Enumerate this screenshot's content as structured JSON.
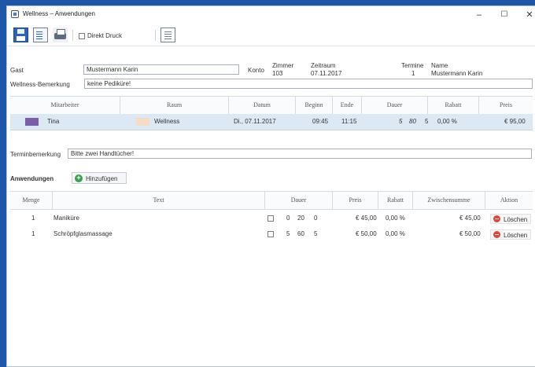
{
  "window": {
    "title": "Wellness – Anwendungen",
    "controls": {
      "minimize": "–",
      "maximize": "☐",
      "close": "✕"
    }
  },
  "toolbar": {
    "icons": [
      "save-icon",
      "preview-icon",
      "printer-icon",
      "list-icon"
    ],
    "direkt_druck_label": "Direkt Druck"
  },
  "guest": {
    "label": "Gast",
    "value": "Mustermann Karin",
    "konto_label": "Konto",
    "zimmer_label": "Zimmer",
    "zimmer_value": "103",
    "zeitraum_label": "Zeitraum",
    "zeitraum_value": "07.11.2017",
    "termine_label": "Termine",
    "termine_value": "1",
    "name_label": "Name",
    "name_value": "Mustermann Karin"
  },
  "wellness_bemerkung": {
    "label": "Wellness-Bemerkung",
    "value": "keine Pediküre!"
  },
  "appointments": {
    "columns": [
      "Mitarbeiter",
      "Raum",
      "Datum",
      "Beginn",
      "Ende",
      "Dauer",
      "Rabatt",
      "Preis"
    ],
    "rows": [
      {
        "mitarbeiter": "Tina",
        "mitarbeiter_color": "#7b5ea7",
        "raum": "Wellness",
        "raum_color": "#f6dcc3",
        "datum": "Di., 07.11.2017",
        "beginn": "09:45",
        "ende": "11:15",
        "dauer_a": "5",
        "dauer_b": "80",
        "dauer_c": "5",
        "rabatt": "0,00 %",
        "preis": "€ 95,00"
      }
    ]
  },
  "terminbemerkung": {
    "label": "Terminbemerkung",
    "value": "Bitte zwei Handtücher!"
  },
  "anwendungen": {
    "label": "Anwendungen",
    "add_label": "Hinzufügen",
    "columns": [
      "Menge",
      "Text",
      "Dauer",
      "Preis",
      "Rabatt",
      "Zwischensumme",
      "Aktion"
    ],
    "rows": [
      {
        "menge": "1",
        "text": "Maniküre",
        "dauer_a": "0",
        "dauer_b": "20",
        "dauer_c": "0",
        "preis": "€ 45,00",
        "rabatt": "0,00 %",
        "zwischensumme": "€ 45,00",
        "aktion": "Löschen"
      },
      {
        "menge": "1",
        "text": "Schröpfglasmassage",
        "dauer_a": "5",
        "dauer_b": "60",
        "dauer_c": "5",
        "preis": "€ 50,00",
        "rabatt": "0,00 %",
        "zwischensumme": "€ 50,00",
        "aktion": "Löschen"
      }
    ]
  }
}
